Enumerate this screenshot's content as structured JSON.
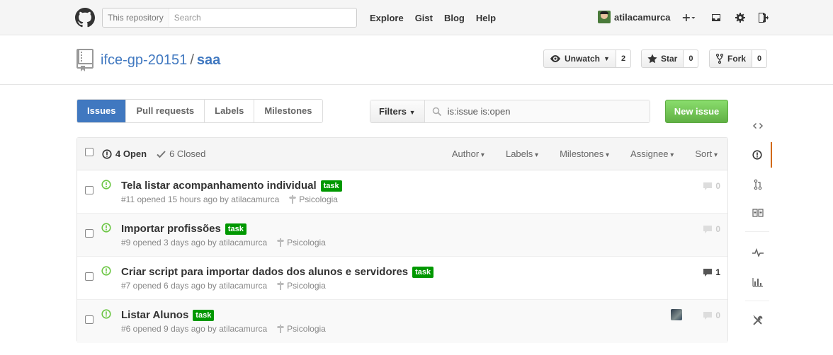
{
  "header": {
    "search_scope": "This repository",
    "search_placeholder": "Search",
    "nav": [
      "Explore",
      "Gist",
      "Blog",
      "Help"
    ],
    "username": "atilacamurca"
  },
  "repo": {
    "owner": "ifce-gp-20151",
    "separator": "/",
    "name": "saa",
    "watch_label": "Unwatch",
    "watch_count": "2",
    "star_label": "Star",
    "star_count": "0",
    "fork_label": "Fork",
    "fork_count": "0"
  },
  "subnav": {
    "tabs": [
      "Issues",
      "Pull requests",
      "Labels",
      "Milestones"
    ],
    "filters_label": "Filters",
    "query": "is:issue is:open",
    "new_issue_label": "New issue"
  },
  "list_header": {
    "open_label": "4 Open",
    "closed_label": "6 Closed",
    "filters": [
      "Author",
      "Labels",
      "Milestones",
      "Assignee",
      "Sort"
    ]
  },
  "issues": [
    {
      "title": "Tela listar acompanhamento individual",
      "label": "task",
      "meta": "#11 opened 15 hours ago by atilacamurca",
      "milestone": "Psicologia",
      "comments": "0",
      "has_comments": false,
      "assignee": false
    },
    {
      "title": "Importar profissões",
      "label": "task",
      "meta": "#9 opened 3 days ago by atilacamurca",
      "milestone": "Psicologia",
      "comments": "0",
      "has_comments": false,
      "assignee": false
    },
    {
      "title": "Criar script para importar dados dos alunos e servidores",
      "label": "task",
      "meta": "#7 opened 6 days ago by atilacamurca",
      "milestone": "Psicologia",
      "comments": "1",
      "has_comments": true,
      "assignee": false
    },
    {
      "title": "Listar Alunos",
      "label": "task",
      "meta": "#6 opened 9 days ago by atilacamurca",
      "milestone": "Psicologia",
      "comments": "0",
      "has_comments": false,
      "assignee": true
    }
  ],
  "colors": {
    "accent": "#4078c0",
    "label_task": "#009800",
    "open_icon": "#6cc644",
    "new_issue": "#60b044",
    "sidebar_selected": "#d26911"
  },
  "sidebar_icons": [
    "code-icon",
    "issues-icon",
    "pull-request-icon",
    "wiki-icon",
    "pulse-icon",
    "graphs-icon",
    "settings-icon"
  ]
}
